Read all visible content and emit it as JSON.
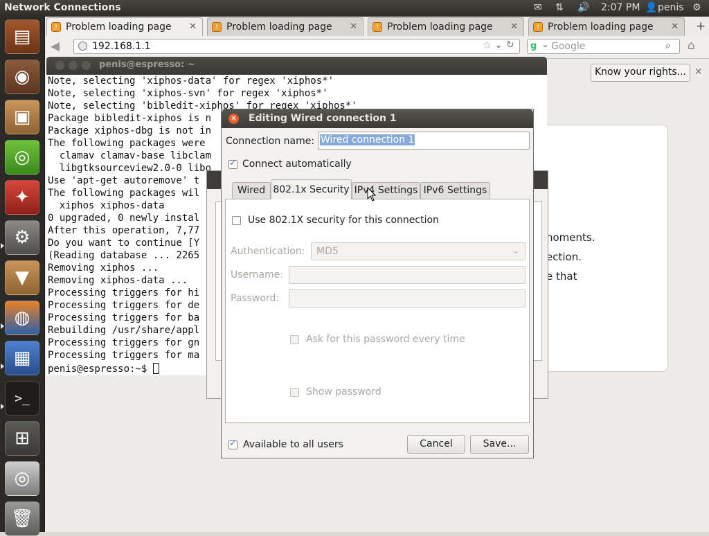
{
  "top_panel": {
    "app_title": "Network Connections",
    "tray": {
      "mail_icon": "mail-icon",
      "network_icon": "network-icon",
      "volume_icon": "volume-icon",
      "clock": "2:07 PM",
      "user": "penis"
    }
  },
  "launcher": {
    "items": [
      {
        "name": "files-folder-launcher"
      },
      {
        "name": "speaker-launcher"
      },
      {
        "name": "package-launcher"
      },
      {
        "name": "ubuntu-one-launcher"
      },
      {
        "name": "settings-wand-launcher"
      },
      {
        "name": "system-settings-launcher"
      },
      {
        "name": "package-download-launcher"
      },
      {
        "name": "firefox-launcher"
      },
      {
        "name": "network-connections-launcher"
      },
      {
        "name": "terminal-launcher"
      },
      {
        "name": "workspace-switcher-launcher"
      },
      {
        "name": "dvd-launcher"
      },
      {
        "name": "trash-launcher"
      }
    ],
    "terminal_glyph": ">_"
  },
  "browser": {
    "tabs": [
      {
        "label": "Problem loading page"
      },
      {
        "label": "Problem loading page"
      },
      {
        "label": "Problem loading page"
      },
      {
        "label": "Problem loading page"
      }
    ],
    "url": "192.168.1.1",
    "search_placeholder": "Google",
    "notification_button": "Know your rights...",
    "page_lines": [
      "noments.",
      "ection.",
      "e that"
    ]
  },
  "terminal": {
    "title": "penis@espresso: ~",
    "lines": [
      "Note, selecting 'xiphos-data' for regex 'xiphos*'",
      "Note, selecting 'xiphos-svn' for regex 'xiphos*'",
      "Note, selecting 'bibledit-xiphos' for regex 'xiphos*'",
      "Package bibledit-xiphos is n",
      "Package xiphos-dbg is not in",
      "The following packages were",
      "  clamav clamav-base libclam",
      "  libgtksourceview2.0-0 libo",
      "Use 'apt-get autoremove' t",
      "The following packages wil",
      "  xiphos xiphos-data",
      "0 upgraded, 0 newly instal",
      "After this operation, 7,77",
      "Do you want to continue [Y",
      "(Reading database ... 2265",
      "Removing xiphos ...",
      "Removing xiphos-data ...",
      "Processing triggers for hi",
      "Processing triggers for de",
      "Processing triggers for ba",
      "Rebuilding /usr/share/appl",
      "Processing triggers for gn",
      "Processing triggers for ma"
    ],
    "prompt": "penis@espresso:~$ "
  },
  "dialog": {
    "title": "Editing Wired connection 1",
    "connection_name_label": "Connection name:",
    "connection_name_value": "Wired connection 1",
    "connect_automatically_label": "Connect automatically",
    "connect_automatically_checked": true,
    "tabs": [
      {
        "label": "Wired"
      },
      {
        "label": "802.1x Security"
      },
      {
        "label": "IPv4 Settings"
      },
      {
        "label": "IPv6 Settings"
      }
    ],
    "selected_tab": "802.1x Security",
    "use_8021x_label": "Use 802.1X security for this connection",
    "use_8021x_checked": false,
    "authentication_label": "Authentication:",
    "authentication_value": "MD5",
    "username_label": "Username:",
    "username_value": "",
    "password_label": "Password:",
    "password_value": "",
    "ask_password_label": "Ask for this password every time",
    "show_password_label": "Show password",
    "available_all_users_label": "Available to all users",
    "available_all_users_checked": true,
    "cancel_label": "Cancel",
    "save_label": "Save..."
  },
  "colors": {
    "panel": "#3a3935",
    "launcher": "#2b2a27",
    "selection": "#86abd9",
    "check_accent": "#3e76c4",
    "close_button": "#e2571e"
  }
}
